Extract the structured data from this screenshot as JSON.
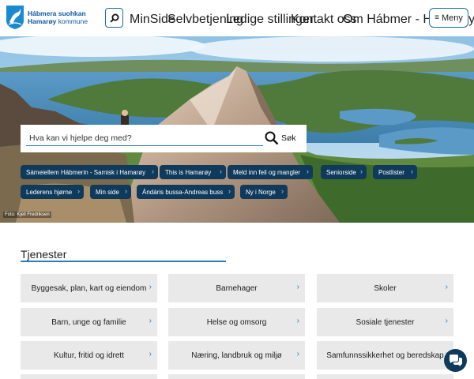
{
  "header": {
    "logo_line1": "Hábmera suohkan",
    "logo_line2_bold": "Hamarøy",
    "logo_line2_rest": " kommune",
    "nav": [
      "MinSide",
      "Selvbetjening",
      "Ledige stillinger",
      "Kontakt oss",
      "Om Hábmer - Hamarøy"
    ],
    "menu_label": "Meny"
  },
  "hero": {
    "search_placeholder": "Hva kan vi hjelpe deg med?",
    "search_button": "Søk",
    "photo_credit": "Foto: Kjell Fredriksen",
    "quicklinks": [
      "Sámeiellem Hábmerin - Samisk i Hamarøy",
      "This is Hamarøy",
      "Meld inn feil og mangler",
      "Seniorside",
      "Postlister",
      "Lederens hjørne",
      "Min side",
      "Ándáris bussa-Andreas buss",
      "Ny i Norge"
    ]
  },
  "services": {
    "title": "Tjenester",
    "items": [
      "Byggesak, plan, kart og eiendom",
      "Barnehager",
      "Skoler",
      "Barn, unge og familie",
      "Helse og omsorg",
      "Sosiale tjenester",
      "Kultur, fritid og idrett",
      "Næring, landbruk og miljø",
      "Samfunnssikkerhet og beredskap"
    ]
  },
  "colors": {
    "brand_blue": "#1a6fa3",
    "chip_bg": "#0f3a5c",
    "card_bg": "#e9e9e9"
  }
}
